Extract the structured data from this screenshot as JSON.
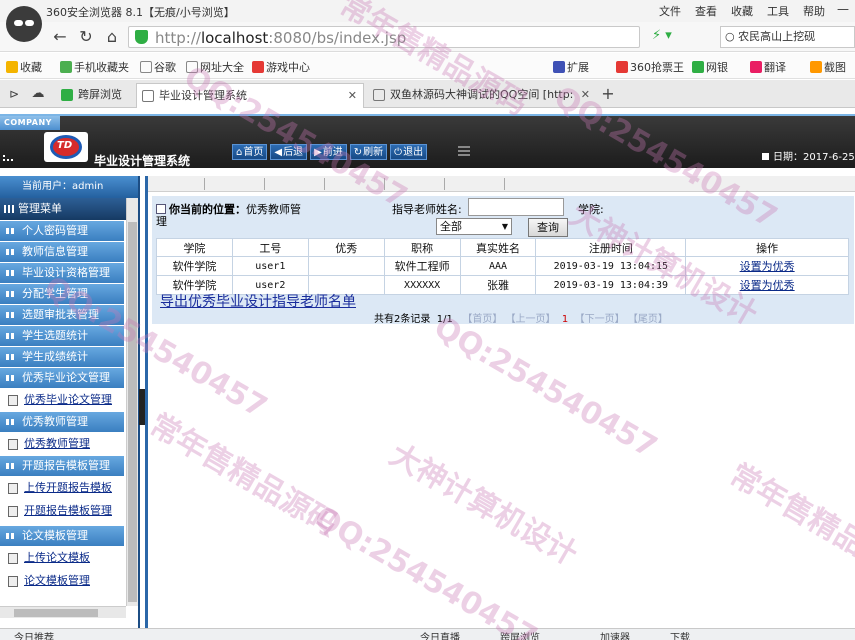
{
  "browser": {
    "window_title": "360安全浏览器 8.1【无痕/小号浏览】",
    "menu": [
      "文件",
      "查看",
      "收藏",
      "工具",
      "帮助"
    ],
    "address": {
      "scheme": "http://",
      "host": "localhost",
      "port_path": ":8080/bs/index.jsp"
    },
    "search_text": "农民高山上挖砚",
    "bookmarks": [
      "收藏",
      "手机收藏夹",
      "谷歌",
      "网址大全",
      "游戏中心"
    ],
    "toolbar_right": [
      "扩展",
      "360抢票王",
      "网银",
      "翻译",
      "截图"
    ],
    "tabs": [
      {
        "label": "跨屏浏览"
      },
      {
        "label": "毕业设计管理系统"
      },
      {
        "label": "双鱼林源码大神调试的QQ空间 [http:"
      }
    ],
    "status_left": "今日推荐",
    "status_right": [
      "今日直播",
      "跨屏浏览",
      "加速器",
      "下载"
    ]
  },
  "header": {
    "company": "COMPANY",
    "emblem_text": "TD",
    "system_title": "毕业设计管理系统",
    "buttons": [
      {
        "label": "首页",
        "icon": "⌂"
      },
      {
        "label": "后退",
        "icon": "◀"
      },
      {
        "label": "前进",
        "icon": "▶"
      },
      {
        "label": "刷新",
        "icon": "↻"
      },
      {
        "label": "退出",
        "icon": "⏻"
      }
    ],
    "date": "日期：2017-6-25"
  },
  "sidebar": {
    "current_user": "当前用户：admin",
    "menu_title": "管理菜单",
    "items_top": [
      "个人密码管理",
      "教师信息管理",
      "毕业设计资格管理",
      "分配学生管理",
      "选题审批表管理",
      "学生选题统计",
      "学生成绩统计",
      "优秀毕业论文管理"
    ],
    "sub_thesis": "优秀毕业论文管理",
    "group_teacher": "优秀教师管理",
    "sub_teacher": "优秀教师管理",
    "group_report": "开题报告模板管理",
    "sub_report": [
      "上传开题报告模板",
      "开题报告模板管理"
    ],
    "group_paper": "论文模板管理",
    "sub_paper": [
      "上传论文模板",
      "论文模板管理"
    ]
  },
  "content": {
    "position_label": "你当前的位置：",
    "position_value": "优秀教师管理",
    "teacher_name_label": "指导老师姓名:",
    "teacher_name_value": "",
    "college_label": "学院:",
    "college_select": "全部",
    "query_button": "查询",
    "columns": [
      "学院",
      "工号",
      "优秀",
      "职称",
      "真实姓名",
      "注册时间",
      "操作"
    ],
    "rows": [
      {
        "college": "软件学院",
        "id": "user1",
        "excellent": "",
        "title": "软件工程师",
        "name": "AAA",
        "time": "2019-03-19 13:04:15",
        "action": "设置为优秀"
      },
      {
        "college": "软件学院",
        "id": "user2",
        "excellent": "",
        "title": "XXXXXX",
        "name": "张雅",
        "time": "2019-03-19 13:04:39",
        "action": "设置为优秀"
      }
    ],
    "export_link": "导出优秀毕业设计指导老师名单",
    "pager": {
      "total": "共有2条记录",
      "page": "1/1",
      "first": "【首页】",
      "prev": "【上一页】",
      "current": "1",
      "next": "【下一页】",
      "last": "【尾页】"
    }
  },
  "watermarks": [
    "QQ:254540457",
    "大神计算机设计",
    "常年售精品源码"
  ]
}
